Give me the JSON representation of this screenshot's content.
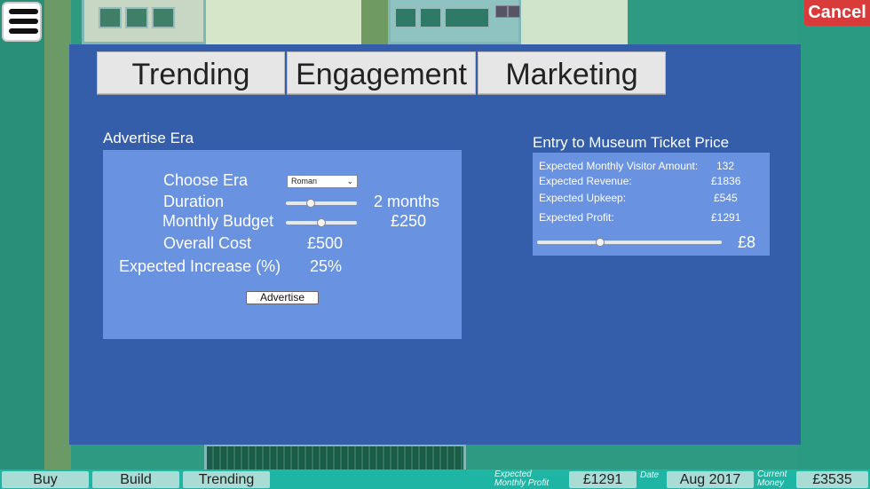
{
  "top": {
    "cancel_label": "Cancel",
    "menu_icon": "hamburger-menu-icon"
  },
  "tabs": [
    {
      "label": "Trending"
    },
    {
      "label": "Engagement"
    },
    {
      "label": "Marketing"
    }
  ],
  "advertise": {
    "title": "Advertise Era",
    "choose_era_label": "Choose Era",
    "era_selected": "Roman",
    "duration_label": "Duration",
    "duration_value": "2 months",
    "duration_slider_fraction": 0.35,
    "budget_label": "Monthly Budget",
    "budget_value": "£250",
    "budget_slider_fraction": 0.5,
    "overall_cost_label": "Overall Cost",
    "overall_cost_value": "£500",
    "expected_increase_label": "Expected Increase (%)",
    "expected_increase_value": "25%",
    "button_label": "Advertise"
  },
  "ticket": {
    "title": "Entry to Museum Ticket Price",
    "rows": [
      {
        "label": "Expected Monthly Visitor Amount:",
        "value": "132"
      },
      {
        "label": "Expected Revenue:",
        "value": "£1836"
      },
      {
        "label": "Expected Upkeep:",
        "value": "£545"
      },
      {
        "label": "Expected Profit:",
        "value": "£1291"
      }
    ],
    "price_value": "£8",
    "price_slider_fraction": 0.34
  },
  "bottombar": {
    "buttons": [
      {
        "label": "Buy"
      },
      {
        "label": "Build"
      },
      {
        "label": "Trending"
      }
    ],
    "expected_caption_1": "Expected",
    "expected_caption_2": "Monthly Profit",
    "expected_value": "£1291",
    "date_caption": "Date",
    "date_value": "Aug 2017",
    "money_caption_1": "Current",
    "money_caption_2": "Money",
    "money_value": "£3535"
  },
  "colors": {
    "panel": "#345eaa",
    "box": "#6992e0",
    "cancel": "#d93b3b",
    "bottombar": "#1fb5a4"
  }
}
